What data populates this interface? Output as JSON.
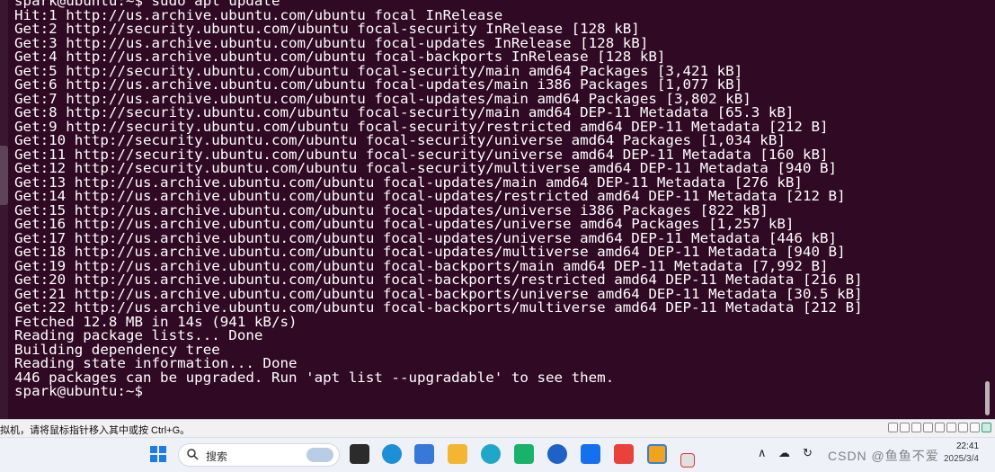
{
  "terminal": {
    "lines": [
      "spark@ubuntu:~$ sudo apt update",
      "Hit:1 http://us.archive.ubuntu.com/ubuntu focal InRelease",
      "Get:2 http://security.ubuntu.com/ubuntu focal-security InRelease [128 kB]",
      "Get:3 http://us.archive.ubuntu.com/ubuntu focal-updates InRelease [128 kB]",
      "Get:4 http://us.archive.ubuntu.com/ubuntu focal-backports InRelease [128 kB]",
      "Get:5 http://security.ubuntu.com/ubuntu focal-security/main amd64 Packages [3,421 kB]",
      "Get:6 http://us.archive.ubuntu.com/ubuntu focal-updates/main i386 Packages [1,077 kB]",
      "Get:7 http://us.archive.ubuntu.com/ubuntu focal-updates/main amd64 Packages [3,802 kB]",
      "Get:8 http://security.ubuntu.com/ubuntu focal-security/main amd64 DEP-11 Metadata [65.3 kB]",
      "Get:9 http://security.ubuntu.com/ubuntu focal-security/restricted amd64 DEP-11 Metadata [212 B]",
      "Get:10 http://security.ubuntu.com/ubuntu focal-security/universe amd64 Packages [1,034 kB]",
      "Get:11 http://security.ubuntu.com/ubuntu focal-security/universe amd64 DEP-11 Metadata [160 kB]",
      "Get:12 http://security.ubuntu.com/ubuntu focal-security/multiverse amd64 DEP-11 Metadata [940 B]",
      "Get:13 http://us.archive.ubuntu.com/ubuntu focal-updates/main amd64 DEP-11 Metadata [276 kB]",
      "Get:14 http://us.archive.ubuntu.com/ubuntu focal-updates/restricted amd64 DEP-11 Metadata [212 B]",
      "Get:15 http://us.archive.ubuntu.com/ubuntu focal-updates/universe i386 Packages [822 kB]",
      "Get:16 http://us.archive.ubuntu.com/ubuntu focal-updates/universe amd64 Packages [1,257 kB]",
      "Get:17 http://us.archive.ubuntu.com/ubuntu focal-updates/universe amd64 DEP-11 Metadata [446 kB]",
      "Get:18 http://us.archive.ubuntu.com/ubuntu focal-updates/multiverse amd64 DEP-11 Metadata [940 B]",
      "Get:19 http://us.archive.ubuntu.com/ubuntu focal-backports/main amd64 DEP-11 Metadata [7,992 B]",
      "Get:20 http://us.archive.ubuntu.com/ubuntu focal-backports/restricted amd64 DEP-11 Metadata [216 B]",
      "Get:21 http://us.archive.ubuntu.com/ubuntu focal-backports/universe amd64 DEP-11 Metadata [30.5 kB]",
      "Get:22 http://us.archive.ubuntu.com/ubuntu focal-backports/multiverse amd64 DEP-11 Metadata [212 B]",
      "Fetched 12.8 MB in 14s (941 kB/s)",
      "Reading package lists... Done",
      "Building dependency tree",
      "Reading state information... Done",
      "446 packages can be upgraded. Run 'apt list --upgradable' to see them.",
      "spark@ubuntu:~$"
    ],
    "background": "#300a24",
    "text_color": "#ffffff"
  },
  "vm_bar": {
    "hint": "拟机，请将鼠标指针移入其中或按 Ctrl+G。"
  },
  "taskbar": {
    "search_label": "搜索",
    "clock_time": "22:41",
    "clock_date": "2025/3/4",
    "watermark": "CSDN @鱼鱼不爱"
  },
  "icons": {
    "windows": "windows-start-icon",
    "search": "search-icon",
    "apps": [
      "file-manager-icon",
      "edge-browser-icon",
      "store-icon",
      "folder-icon",
      "ai-app-icon",
      "chat-icon",
      "arrow-app-icon",
      "kanban-icon",
      "wps-icon",
      "vmware-icon",
      "snip-icon"
    ]
  }
}
